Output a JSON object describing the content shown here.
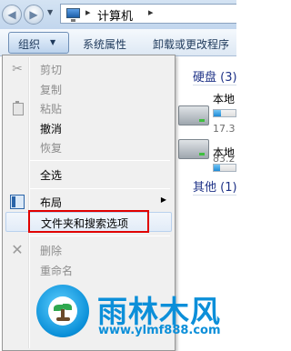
{
  "window": {
    "address_path": "计算机",
    "separator": "▸"
  },
  "toolbar": {
    "organize_label": "组织",
    "system_properties_label": "系统属性",
    "uninstall_label": "卸载或更改程序"
  },
  "content": {
    "group_drives_header": "硬盘 (3)",
    "group_other_header": "其他 (1)",
    "drives": [
      {
        "name": "本地",
        "size": "17.3",
        "used_fraction": 0.35
      },
      {
        "name": "本地",
        "size": "83.2",
        "used_fraction": 0.3
      }
    ]
  },
  "menu": {
    "items": [
      {
        "label": "剪切",
        "enabled": false,
        "icon": "scissors-icon"
      },
      {
        "label": "复制",
        "enabled": false
      },
      {
        "label": "粘贴",
        "enabled": false,
        "icon": "paste-icon"
      },
      {
        "label": "撤消",
        "enabled": true
      },
      {
        "label": "恢复",
        "enabled": false
      },
      {
        "label": "全选",
        "enabled": true
      },
      {
        "label": "布局",
        "enabled": true,
        "icon": "layout-icon",
        "has_submenu": true
      },
      {
        "label": "文件夹和搜索选项",
        "enabled": true,
        "highlighted": true
      },
      {
        "label": "删除",
        "enabled": false,
        "icon": "delete-icon"
      },
      {
        "label": "重命名",
        "enabled": false
      }
    ]
  },
  "watermark": {
    "title": "雨林木风",
    "url": "www.ylmf888.com"
  },
  "colors": {
    "accent": "#0c8fd9",
    "highlight_box": "#e00000",
    "group_header": "#1e3287"
  }
}
